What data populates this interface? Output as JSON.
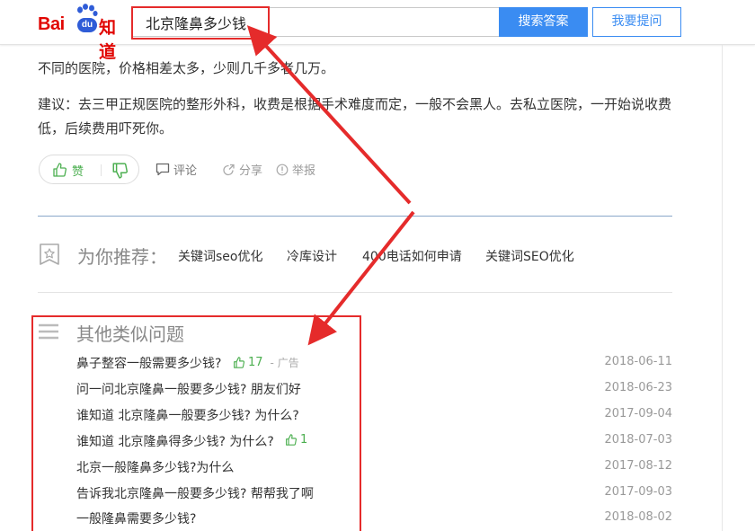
{
  "header": {
    "logo_text": "Bai",
    "logo_du": "du",
    "logo_zhidao": "知道",
    "search_value": "北京隆鼻多少钱",
    "search_button": "搜索答案",
    "ask_button": "我要提问"
  },
  "answer": {
    "paragraph1": "不同的医院，价格相差太多，少则几千多者几万。",
    "paragraph2": "建议：去三甲正规医院的整形外科，收费是根据手术难度而定，一般不会黑人。去私立医院，一开始说收费低，后续费用吓死你。"
  },
  "actions": {
    "like_label": "赞",
    "comment_label": "评论",
    "share_label": "分享",
    "report_label": "举报"
  },
  "recommend": {
    "title": "为你推荐：",
    "items": [
      "关键词seo优化",
      "冷库设计",
      "400电话如何申请",
      "关键词SEO优化"
    ]
  },
  "similar": {
    "title": "其他类似问题",
    "questions": [
      {
        "text": "鼻子整容一般需要多少钱?",
        "likes": "17",
        "ad": "- 广告",
        "date": "2018-06-11"
      },
      {
        "text": "问一问北京隆鼻一般要多少钱? 朋友们好",
        "likes": "",
        "ad": "",
        "date": "2018-06-23"
      },
      {
        "text": "谁知道 北京隆鼻一般要多少钱? 为什么?",
        "likes": "",
        "ad": "",
        "date": "2017-09-04"
      },
      {
        "text": "谁知道 北京隆鼻得多少钱? 为什么?",
        "likes": "1",
        "ad": "",
        "date": "2018-07-03"
      },
      {
        "text": "北京一般隆鼻多少钱?为什么",
        "likes": "",
        "ad": "",
        "date": "2017-08-12"
      },
      {
        "text": "告诉我北京隆鼻一般要多少钱? 帮帮我了啊",
        "likes": "",
        "ad": "",
        "date": "2017-09-03"
      },
      {
        "text": "一般隆鼻需要多少钱?",
        "likes": "",
        "ad": "",
        "date": "2018-08-02"
      }
    ]
  },
  "colors": {
    "brand_red": "#e10602",
    "brand_blue": "#3a8cf2",
    "like_green": "#4caf50",
    "annotation_red": "#e52b2b"
  }
}
